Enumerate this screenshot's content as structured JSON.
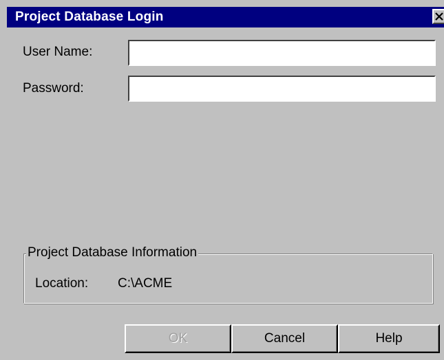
{
  "window": {
    "title": "Project Database Login",
    "close_icon": "close-icon"
  },
  "form": {
    "username_label": "User Name:",
    "username_value": "",
    "password_label": "Password:",
    "password_value": ""
  },
  "info_group": {
    "legend": "Project Database Information",
    "location_label": "Location:",
    "location_value": "C:\\ACME"
  },
  "buttons": {
    "ok_label": "OK",
    "ok_enabled": false,
    "cancel_label": "Cancel",
    "help_label": "Help"
  },
  "colors": {
    "titlebar": "#000080",
    "face": "#c0c0c0",
    "disabled_text": "#a0a0a0"
  }
}
